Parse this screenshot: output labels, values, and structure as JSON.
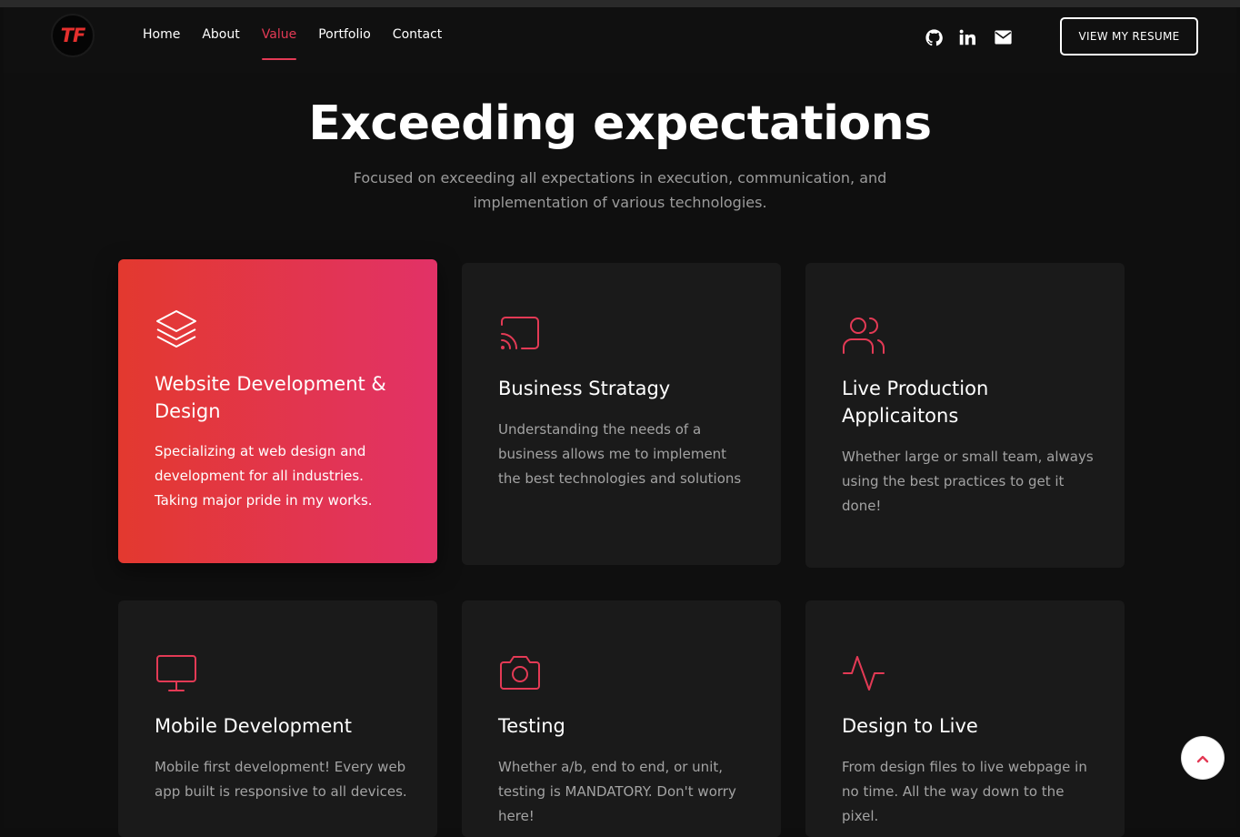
{
  "logo": {
    "text": "TF"
  },
  "nav": {
    "links": [
      "Home",
      "About",
      "Value",
      "Portfolio",
      "Contact"
    ],
    "active": "Value",
    "social_icons": [
      "github-icon",
      "linkedin-icon",
      "mail-icon"
    ],
    "resume_button": "VIEW MY RESUME"
  },
  "hero": {
    "title": "Exceeding expectations",
    "subtitle": "Focused on exceeding all expectations in execution, communication, and implementation of various technologies."
  },
  "cards": [
    {
      "icon": "layers-icon",
      "title": "Website Development & Design",
      "description": "Specializing at web design and development for all industries. Taking major pride in my works.",
      "featured": true
    },
    {
      "icon": "cast-icon",
      "title": "Business Stratagy",
      "description": "Understanding the needs of a business allows me to implement the best technologies and solutions"
    },
    {
      "icon": "users-icon",
      "title": "Live Production Applicaitons",
      "description": "Whether large or small team, always using the best practices to get it done!"
    },
    {
      "icon": "monitor-icon",
      "title": "Mobile Development",
      "description": "Mobile first development! Every web app built is responsive to all devices."
    },
    {
      "icon": "camera-icon",
      "title": "Testing",
      "description": "Whether a/b, end to end, or unit, testing is MANDATORY. Don't worry here!"
    },
    {
      "icon": "activity-icon",
      "title": "Design to Live",
      "description": "From design files to live webpage in no time. All the way down to the pixel."
    }
  ],
  "colors": {
    "accent": "#e33a55",
    "gradient_start": "#e3392f",
    "gradient_end": "#e23267",
    "background": "#0f0f0f",
    "card": "#1a1a1a"
  },
  "scroll_top_icon": "chevron-up-icon"
}
